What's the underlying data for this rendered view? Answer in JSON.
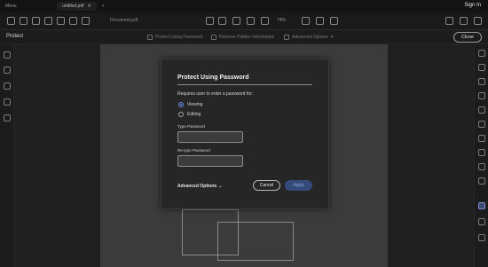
{
  "app": {
    "menu_label": "Menu",
    "doc_tab": "untitled.pdf",
    "sign_in": "Sign In",
    "document_name": "Document.pdf",
    "zoom": "74%"
  },
  "subbar": {
    "panel_title": "Protect",
    "tools": [
      "Protect Using Password",
      "Remove Hidden Information",
      "Advanced Options"
    ],
    "close_label": "Close"
  },
  "dialog": {
    "title": "Protect Using Password",
    "description": "Requires user to enter a password for:",
    "options": [
      {
        "label": "Viewing",
        "selected": true
      },
      {
        "label": "Editing",
        "selected": false
      }
    ],
    "type_password_label": "Type Password",
    "type_password_value": "",
    "retype_password_label": "Re-type Password",
    "retype_password_value": "",
    "advanced_options": "Advanced Options",
    "cancel_label": "Cancel",
    "apply_label": "Apply"
  },
  "colors": {
    "accent": "#6e8ff0",
    "apply_bg": "#344a7a"
  }
}
